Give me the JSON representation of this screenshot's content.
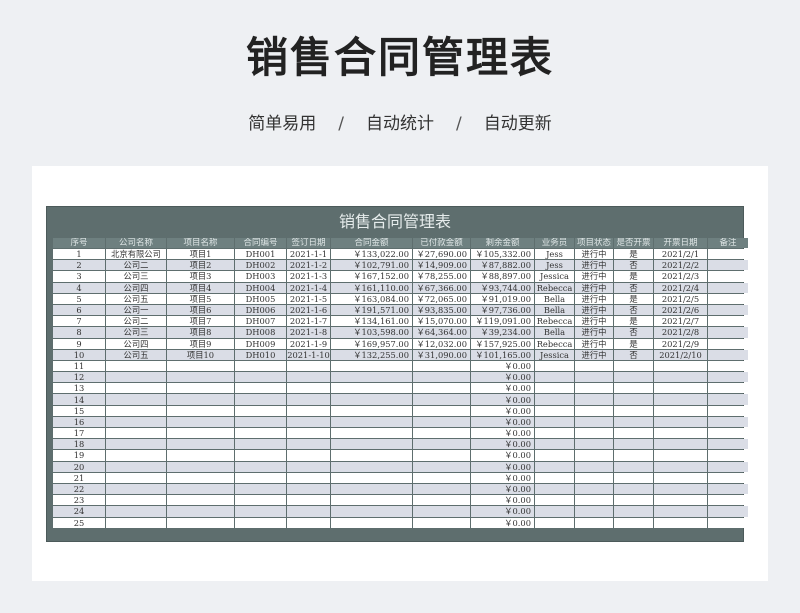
{
  "page": {
    "title": "销售合同管理表",
    "subtitle_items": [
      "简单易用",
      "自动统计",
      "自动更新"
    ],
    "separator": "/"
  },
  "sheet": {
    "title": "销售合同管理表",
    "columns": [
      "序号",
      "公司名称",
      "项目名称",
      "合同编号",
      "签订日期",
      "合同金额",
      "已付款金额",
      "剩余金额",
      "业务员",
      "项目状态",
      "是否开票",
      "开票日期",
      "备注"
    ],
    "rows": [
      [
        "1",
        "北京有限公司",
        "项目1",
        "DH001",
        "2021-1-1",
        "￥133,022.00",
        "￥27,690.00",
        "￥105,332.00",
        "Jess",
        "进行中",
        "是",
        "2021/2/1",
        ""
      ],
      [
        "2",
        "公司二",
        "项目2",
        "DH002",
        "2021-1-2",
        "￥102,791.00",
        "￥14,909.00",
        "￥87,882.00",
        "Jess",
        "进行中",
        "否",
        "2021/2/2",
        ""
      ],
      [
        "3",
        "公司三",
        "项目3",
        "DH003",
        "2021-1-3",
        "￥167,152.00",
        "￥78,255.00",
        "￥88,897.00",
        "Jessica",
        "进行中",
        "是",
        "2021/2/3",
        ""
      ],
      [
        "4",
        "公司四",
        "项目4",
        "DH004",
        "2021-1-4",
        "￥161,110.00",
        "￥67,366.00",
        "￥93,744.00",
        "Rebecca",
        "进行中",
        "否",
        "2021/2/4",
        ""
      ],
      [
        "5",
        "公司五",
        "项目5",
        "DH005",
        "2021-1-5",
        "￥163,084.00",
        "￥72,065.00",
        "￥91,019.00",
        "Bella",
        "进行中",
        "是",
        "2021/2/5",
        ""
      ],
      [
        "6",
        "公司一",
        "项目6",
        "DH006",
        "2021-1-6",
        "￥191,571.00",
        "￥93,835.00",
        "￥97,736.00",
        "Bella",
        "进行中",
        "否",
        "2021/2/6",
        ""
      ],
      [
        "7",
        "公司二",
        "项目7",
        "DH007",
        "2021-1-7",
        "￥134,161.00",
        "￥15,070.00",
        "￥119,091.00",
        "Rebecca",
        "进行中",
        "是",
        "2021/2/7",
        ""
      ],
      [
        "8",
        "公司三",
        "项目8",
        "DH008",
        "2021-1-8",
        "￥103,598.00",
        "￥64,364.00",
        "￥39,234.00",
        "Bella",
        "进行中",
        "否",
        "2021/2/8",
        ""
      ],
      [
        "9",
        "公司四",
        "项目9",
        "DH009",
        "2021-1-9",
        "￥169,957.00",
        "￥12,032.00",
        "￥157,925.00",
        "Rebecca",
        "进行中",
        "是",
        "2021/2/9",
        ""
      ],
      [
        "10",
        "公司五",
        "项目10",
        "DH010",
        "2021-1-10",
        "￥132,255.00",
        "￥31,090.00",
        "￥101,165.00",
        "Jessica",
        "进行中",
        "否",
        "2021/2/10",
        ""
      ],
      [
        "11",
        "",
        "",
        "",
        "",
        "",
        "",
        "￥0.00",
        "",
        "",
        "",
        "",
        ""
      ],
      [
        "12",
        "",
        "",
        "",
        "",
        "",
        "",
        "￥0.00",
        "",
        "",
        "",
        "",
        ""
      ],
      [
        "13",
        "",
        "",
        "",
        "",
        "",
        "",
        "￥0.00",
        "",
        "",
        "",
        "",
        ""
      ],
      [
        "14",
        "",
        "",
        "",
        "",
        "",
        "",
        "￥0.00",
        "",
        "",
        "",
        "",
        ""
      ],
      [
        "15",
        "",
        "",
        "",
        "",
        "",
        "",
        "￥0.00",
        "",
        "",
        "",
        "",
        ""
      ],
      [
        "16",
        "",
        "",
        "",
        "",
        "",
        "",
        "￥0.00",
        "",
        "",
        "",
        "",
        ""
      ],
      [
        "17",
        "",
        "",
        "",
        "",
        "",
        "",
        "￥0.00",
        "",
        "",
        "",
        "",
        ""
      ],
      [
        "18",
        "",
        "",
        "",
        "",
        "",
        "",
        "￥0.00",
        "",
        "",
        "",
        "",
        ""
      ],
      [
        "19",
        "",
        "",
        "",
        "",
        "",
        "",
        "￥0.00",
        "",
        "",
        "",
        "",
        ""
      ],
      [
        "20",
        "",
        "",
        "",
        "",
        "",
        "",
        "￥0.00",
        "",
        "",
        "",
        "",
        ""
      ],
      [
        "21",
        "",
        "",
        "",
        "",
        "",
        "",
        "￥0.00",
        "",
        "",
        "",
        "",
        ""
      ],
      [
        "22",
        "",
        "",
        "",
        "",
        "",
        "",
        "￥0.00",
        "",
        "",
        "",
        "",
        ""
      ],
      [
        "23",
        "",
        "",
        "",
        "",
        "",
        "",
        "￥0.00",
        "",
        "",
        "",
        "",
        ""
      ],
      [
        "24",
        "",
        "",
        "",
        "",
        "",
        "",
        "￥0.00",
        "",
        "",
        "",
        "",
        ""
      ],
      [
        "25",
        "",
        "",
        "",
        "",
        "",
        "",
        "￥0.00",
        "",
        "",
        "",
        "",
        ""
      ]
    ]
  },
  "colors": {
    "background": "#eef0f3",
    "sheet_frame": "#5e6e6e",
    "header_cell": "#6e8080",
    "row_alt": "#dadde6"
  }
}
